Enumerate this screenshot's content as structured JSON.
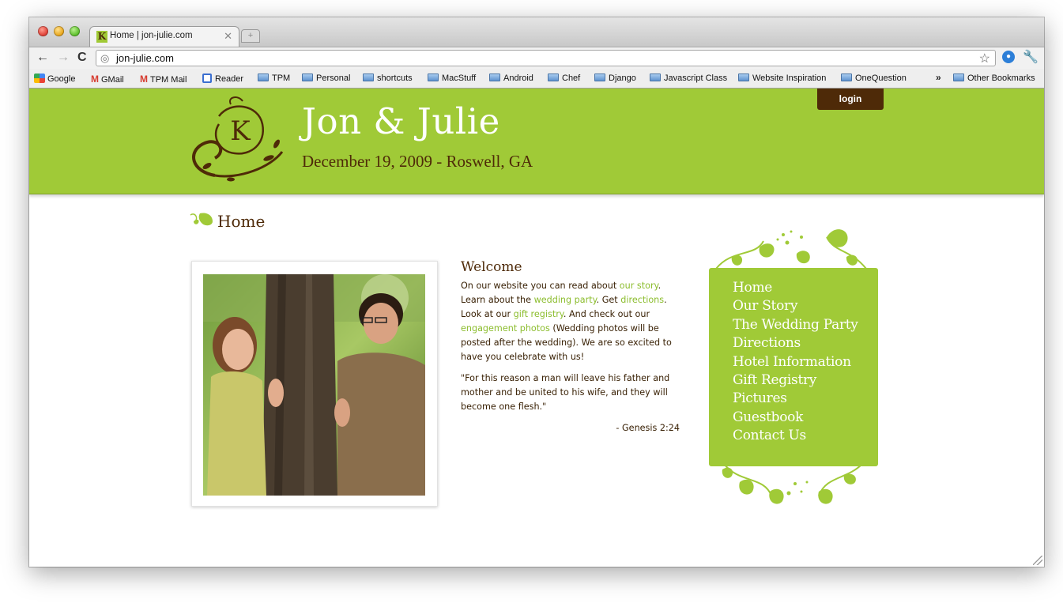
{
  "browser": {
    "tab_title": "Home | jon-julie.com",
    "tab_favicon_letter": "K",
    "url": "jon-julie.com",
    "bookmarks": [
      "Google",
      "GMail",
      "TPM Mail",
      "Reader",
      "TPM",
      "Personal",
      "shortcuts",
      "MacStuff",
      "Android",
      "Chef",
      "Django",
      "Javascript Class",
      "Website Inspiration",
      "OneQuestion"
    ],
    "bookmarks_overflow": "»",
    "other_bookmarks": "Other Bookmarks"
  },
  "header": {
    "login": "login",
    "monogram_letter": "K",
    "title": "Jon & Julie",
    "subtitle": "December 19, 2009 - Roswell, GA"
  },
  "page": {
    "heading": "Home"
  },
  "welcome": {
    "title": "Welcome",
    "p1": "On our website you can read about ",
    "link_story": "our story",
    "p2": ". Learn about the ",
    "link_party": "wedding party",
    "p3": ". Get ",
    "link_directions": "directions",
    "p4": ". Look at our ",
    "link_registry": "gift registry",
    "p5": ". And check out our ",
    "link_photos": "engagement photos",
    "p6": " (Wedding photos will be posted after the wedding). We are so excited to have you celebrate with us!",
    "quote": "\"For this reason a man will leave his father and mother and be united to his wife, and they will become one flesh.\"",
    "verse": "- Genesis 2:24"
  },
  "nav": {
    "items": [
      "Home",
      "Our Story",
      "The Wedding Party",
      "Directions",
      "Hotel Information",
      "Gift Registry",
      "Pictures",
      "Guestbook",
      "Contact Us"
    ]
  },
  "colors": {
    "brand_green": "#a0ca37",
    "brand_brown": "#4e2a08",
    "link_green": "#8cbd2e"
  }
}
